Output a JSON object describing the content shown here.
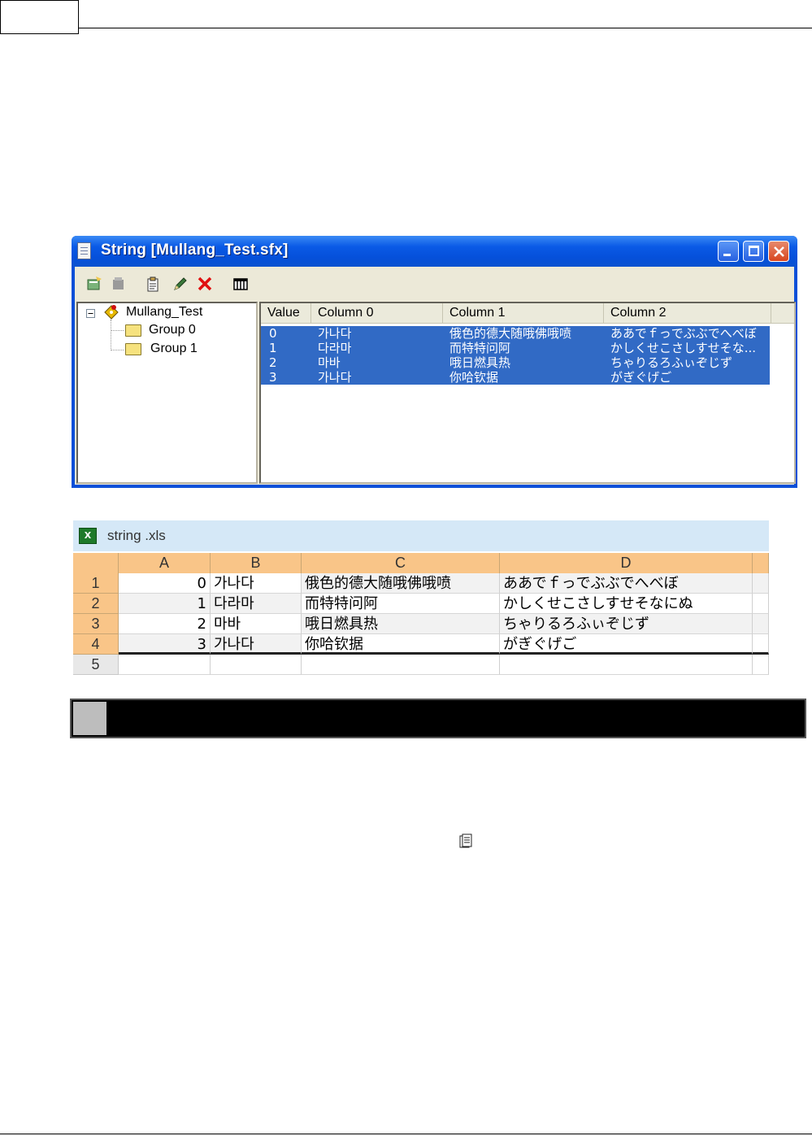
{
  "window": {
    "title": "String [Mullang_Test.sfx]",
    "controls": [
      "minimize",
      "maximize",
      "close"
    ],
    "toolbar_icons": [
      "new-string-icon",
      "disabled-icon",
      "paste-icon",
      "edit-pencil-icon",
      "delete-x-icon",
      "columns-icon"
    ],
    "tree": {
      "root": "Mullang_Test",
      "groups": [
        "Group 0",
        "Group 1"
      ]
    },
    "listview": {
      "columns": [
        "Value",
        "Column 0",
        "Column 1",
        "Column 2"
      ],
      "rows": [
        {
          "value": "0",
          "c0": "가나다",
          "c1": "俄色的德大随哦佛哦喷",
          "c2": "ああでｆっでぶぶでへべぼ"
        },
        {
          "value": "1",
          "c0": "다라마",
          "c1": "而特特问阿",
          "c2": "かしくせこさしすせそな..."
        },
        {
          "value": "2",
          "c0": "마바",
          "c1": "哦日燃具热",
          "c2": "ちゃりるろふぃぞじず"
        },
        {
          "value": "3",
          "c0": "가나다",
          "c1": "你哈钦据",
          "c2": "がぎぐげご"
        }
      ]
    }
  },
  "excel": {
    "filename": "string .xls",
    "columns": [
      "A",
      "B",
      "C",
      "D"
    ],
    "row_numbers": [
      "1",
      "2",
      "3",
      "4",
      "5"
    ],
    "rows": [
      {
        "a": "0",
        "b": "가나다",
        "c": "俄色的德大随哦佛哦喷",
        "d": "ああでｆっでぶぶでへべぼ"
      },
      {
        "a": "1",
        "b": "다라마",
        "c": "而特特问阿",
        "d": "かしくせこさしすせそなにぬ"
      },
      {
        "a": "2",
        "b": "마바",
        "c": "哦日燃具热",
        "d": "ちゃりるろふぃぞじず"
      },
      {
        "a": "3",
        "b": "가나다",
        "c": "你哈钦据",
        "d": "がぎぐげご"
      }
    ]
  }
}
